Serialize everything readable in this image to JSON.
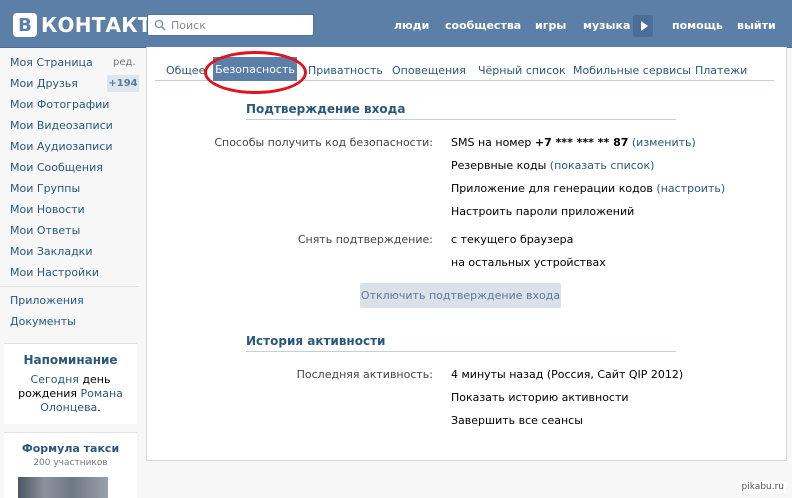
{
  "header": {
    "logo_letter": "В",
    "logo_text": "КОНТАКТЕ",
    "search_placeholder": "Поиск",
    "nav": [
      "люди",
      "сообщества",
      "игры",
      "музыка",
      "помощь",
      "выйти"
    ]
  },
  "sidebar": {
    "items": [
      "Моя Страница",
      "Мои Друзья",
      "Мои Фотографии",
      "Мои Видеозаписи",
      "Мои Аудиозаписи",
      "Мои Сообщения",
      "Мои Группы",
      "Мои Новости",
      "Мои Ответы",
      "Мои Закладки",
      "Мои Настройки"
    ],
    "edit_label": "ред.",
    "friends_badge": "+194",
    "extra_items": [
      "Приложения",
      "Документы"
    ],
    "reminder": {
      "title": "Напоминание",
      "today": "Сегодня",
      "text_mid": "день рождения",
      "name": "Романа Олонцева",
      "dot": "."
    },
    "group": {
      "title": "Формула такси",
      "members": "200 участников"
    }
  },
  "tabs": {
    "items": [
      "Общее",
      "Безопасность",
      "Приватность",
      "Оповещения",
      "Чёрный список",
      "Мобильные сервисы",
      "Платежи"
    ],
    "active": "Безопасность"
  },
  "login_confirm": {
    "title": "Подтверждение входа",
    "methods_label": "Способы получить код безопасности:",
    "sms_prefix": "SMS на номер",
    "sms_number": "+7 *** *** ** 87",
    "sms_change": "(изменить)",
    "backup_prefix": "Резервные коды",
    "backup_link": "(показать список)",
    "app_prefix": "Приложение для генерации кодов",
    "app_link": "(настроить)",
    "app_passwords": "Настроить пароли приложений",
    "remove_label": "Снять подтверждение:",
    "remove_current": "с текущего браузера",
    "remove_others": "на остальных устройствах",
    "disable_button": "Отключить подтверждение входа"
  },
  "activity": {
    "title": "История активности",
    "last_label": "Последняя активность:",
    "last_value": "4 минуты назад (Россия, Сайт QIP 2012)",
    "show_history": "Показать историю активности",
    "end_sessions": "Завершить все сеансы"
  },
  "watermark": "pikabu.ru",
  "colors": {
    "brand": "#5b7fa6",
    "link": "#2b587a",
    "highlight_ellipse": "#e0141e"
  }
}
